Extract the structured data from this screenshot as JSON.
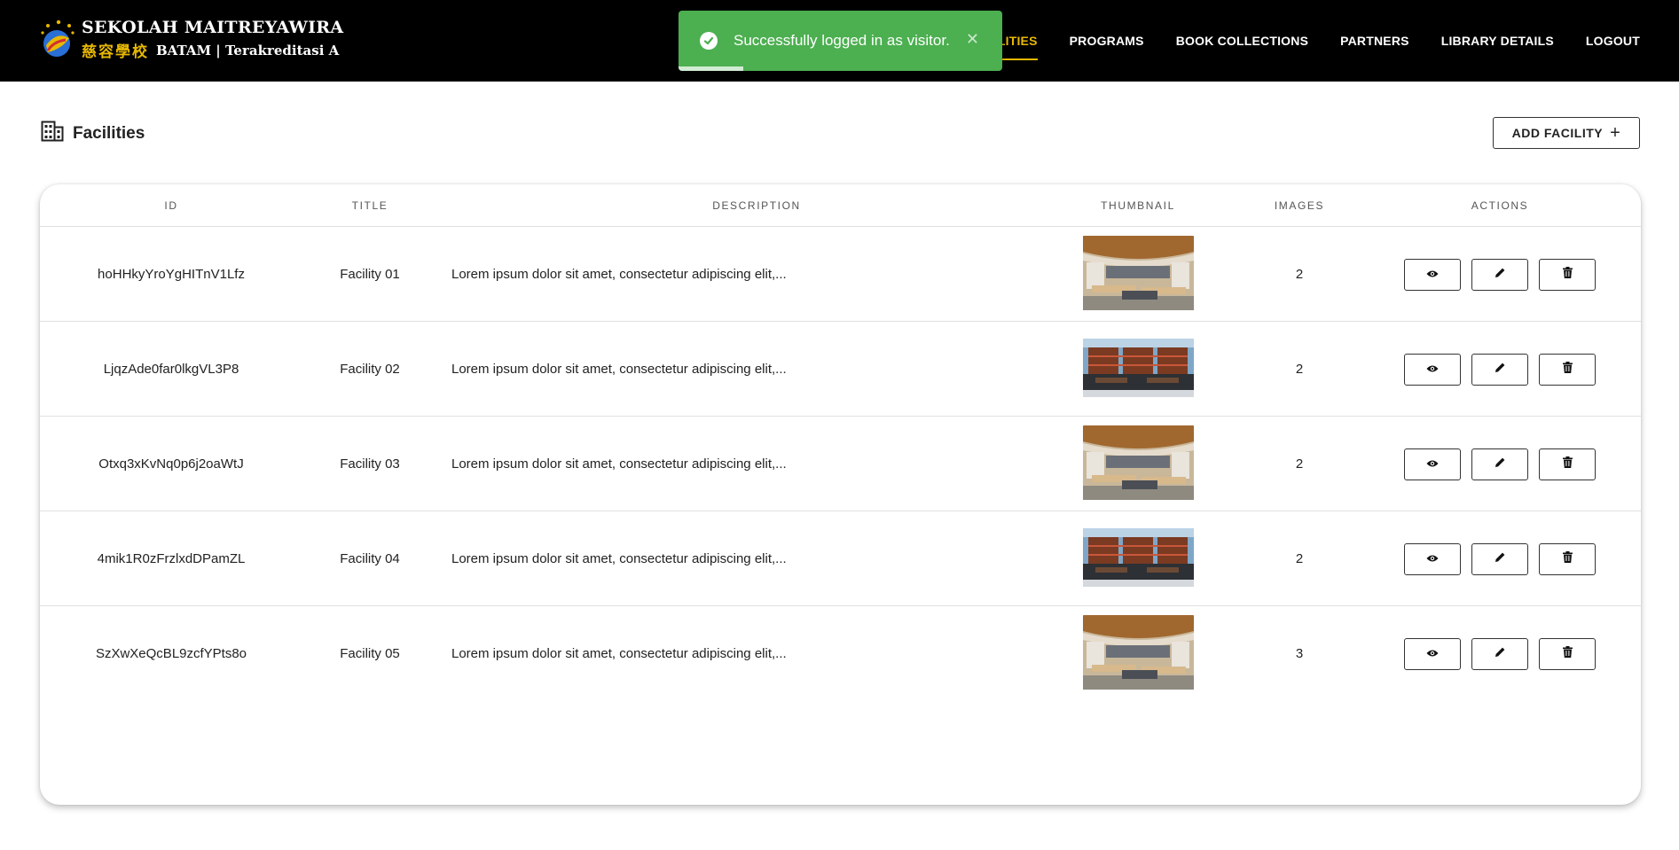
{
  "header": {
    "logo": {
      "line1": "SEKOLAH MAITREYAWIRA",
      "chinese": "慈容學校",
      "line2": "BATAM | Terakreditasi A"
    },
    "nav": [
      {
        "label": "FACILITIES",
        "active": true
      },
      {
        "label": "PROGRAMS",
        "active": false
      },
      {
        "label": "BOOK COLLECTIONS",
        "active": false
      },
      {
        "label": "PARTNERS",
        "active": false
      },
      {
        "label": "LIBRARY DETAILS",
        "active": false
      },
      {
        "label": "LOGOUT",
        "active": false
      }
    ],
    "accent_color": "#e8b800"
  },
  "toast": {
    "message": "Successfully logged in as visitor.",
    "close_icon": "close-icon",
    "status_icon": "check-circle-icon",
    "color": "#4caf50",
    "progress": 0.2
  },
  "page": {
    "title": "Facilities",
    "title_icon": "building-icon",
    "add_button_label": "ADD FACILITY"
  },
  "table": {
    "columns": [
      "ID",
      "TITLE",
      "DESCRIPTION",
      "THUMBNAIL",
      "IMAGES",
      "ACTIONS"
    ],
    "rows": [
      {
        "id": "hoHHkyYroYgHITnV1Lfz",
        "title": "Facility 01",
        "description": "Lorem ipsum dolor sit amet, consectetur adipiscing elit,...",
        "thumbnail": "library-wide",
        "images": "2"
      },
      {
        "id": "LjqzAde0far0lkgVL3P8",
        "title": "Facility 02",
        "description": "Lorem ipsum dolor sit amet, consectetur adipiscing elit,...",
        "thumbnail": "library-shelves",
        "images": "2"
      },
      {
        "id": "Otxq3xKvNq0p6j2oaWtJ",
        "title": "Facility 03",
        "description": "Lorem ipsum dolor sit amet, consectetur adipiscing elit,...",
        "thumbnail": "library-wide",
        "images": "2"
      },
      {
        "id": "4mik1R0zFrzlxdDPamZL",
        "title": "Facility 04",
        "description": "Lorem ipsum dolor sit amet, consectetur adipiscing elit,...",
        "thumbnail": "library-shelves",
        "images": "2"
      },
      {
        "id": "SzXwXeQcBL9zcfYPts8o",
        "title": "Facility 05",
        "description": "Lorem ipsum dolor sit amet, consectetur adipiscing elit,...",
        "thumbnail": "library-wide",
        "images": "3"
      }
    ],
    "action_icons": [
      "eye-icon",
      "pencil-icon",
      "trash-icon"
    ]
  }
}
